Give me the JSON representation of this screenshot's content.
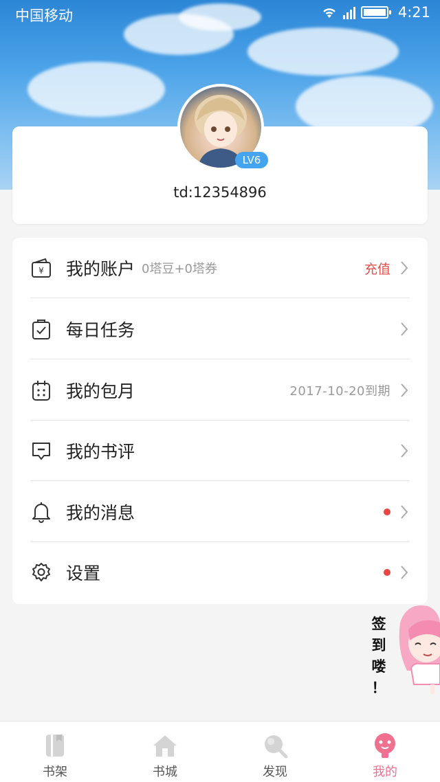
{
  "status_bar": {
    "carrier": "中国移动",
    "time": "4:21"
  },
  "profile": {
    "level": "LV6",
    "user_id": "td:12354896"
  },
  "menu": [
    {
      "label": "我的账户",
      "sub": "0塔豆+0塔券",
      "action": "充值"
    },
    {
      "label": "每日任务"
    },
    {
      "label": "我的包月",
      "expire": "2017-10-20到期"
    },
    {
      "label": "我的书评"
    },
    {
      "label": "我的消息",
      "has_dot": true
    },
    {
      "label": "设置",
      "has_dot": true
    }
  ],
  "mascot": {
    "text": [
      "签",
      "到",
      "喽",
      "！"
    ]
  },
  "tabs": [
    {
      "label": "书架",
      "icon": "bookshelf-icon"
    },
    {
      "label": "书城",
      "icon": "home-icon"
    },
    {
      "label": "发现",
      "icon": "search-icon"
    },
    {
      "label": "我的",
      "icon": "profile-icon",
      "active": true
    }
  ],
  "colors": {
    "accent_red": "#e05050",
    "accent_pink": "#f07090",
    "badge_blue": "#44a4ef"
  }
}
